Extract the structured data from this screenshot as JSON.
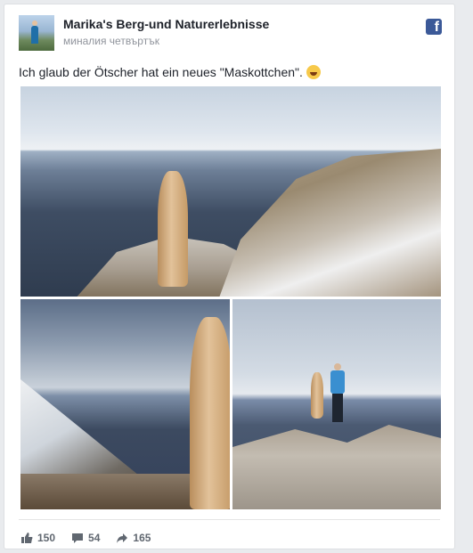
{
  "post": {
    "author": "Marika's Berg-und Naturerlebnisse",
    "time": "миналия четвъртък",
    "text": "Ich glaub der Ötscher hat ein neues \"Maskottchen\".",
    "brand_icon": "facebook-icon",
    "emoji": "laughing-emoji"
  },
  "actions": {
    "likes": "150",
    "comments": "54",
    "shares": "165"
  },
  "colors": {
    "brand": "#3b5998",
    "text": "#1d2129",
    "muted": "#90949c"
  }
}
